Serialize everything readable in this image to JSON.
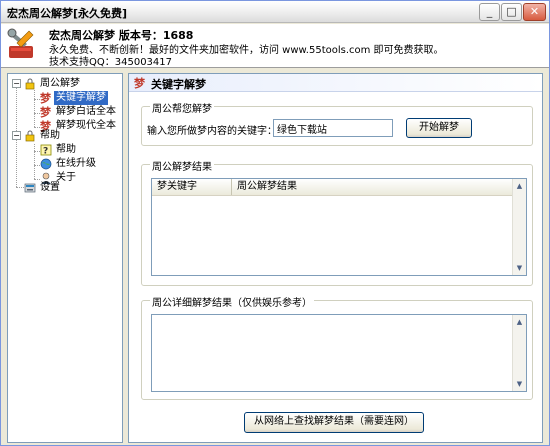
{
  "window": {
    "title": "宏杰周公解梦[永久免费]",
    "buttons": {
      "minimize": "_",
      "maximize": "□",
      "close": "✕"
    }
  },
  "header": {
    "line1": "宏杰周公解梦  版本号：1688",
    "line2": "永久免费、不断创新！最好的文件夹加密软件，访问 www.55tools.com 即可免费获取。",
    "line3": "技术支持QQ：345003417"
  },
  "tree": {
    "items": [
      {
        "label": "周公解梦"
      },
      {
        "label": "关键字解梦"
      },
      {
        "label": "解梦白话全本"
      },
      {
        "label": "解梦现代全本"
      },
      {
        "label": "帮助"
      },
      {
        "label": "帮助"
      },
      {
        "label": "在线升级"
      },
      {
        "label": "关于"
      },
      {
        "label": "设置"
      }
    ]
  },
  "panel": {
    "title": "关键字解梦",
    "help_group": {
      "legend": "周公帮您解梦",
      "keyword_label": "输入您所做梦内容的关键字：",
      "keyword_value": "绿色下载站",
      "start_button": "开始解梦"
    },
    "result_group": {
      "legend": "周公解梦结果",
      "columns": [
        "梦关键字",
        "周公解梦结果"
      ]
    },
    "detail_group": {
      "legend": "周公详细解梦结果（仅供娱乐参考）"
    },
    "online_button": "从网络上查找解梦结果（需要连网）"
  }
}
